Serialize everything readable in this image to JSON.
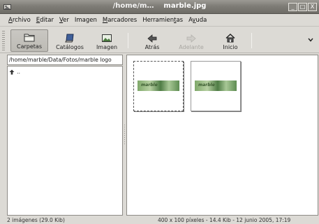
{
  "window": {
    "path": "/home/m…",
    "file": "marble.jpg",
    "controls": [
      "_",
      "□",
      "X"
    ]
  },
  "menubar": [
    {
      "pre": "",
      "u": "A",
      "post": "rchivo"
    },
    {
      "pre": "",
      "u": "E",
      "post": "ditar"
    },
    {
      "pre": "",
      "u": "V",
      "post": "er"
    },
    {
      "pre": "Imagen",
      "u": "",
      "post": ""
    },
    {
      "pre": "",
      "u": "M",
      "post": "arcadores"
    },
    {
      "pre": "Herramien",
      "u": "t",
      "post": "as"
    },
    {
      "pre": "A",
      "u": "y",
      "post": "uda"
    }
  ],
  "toolbar": {
    "carpetas": "Carpetas",
    "catalogos": "Catálogos",
    "imagen": "Imagen",
    "atras": "Atrás",
    "adelante": "Adelante",
    "inicio": "Inicio"
  },
  "path_field": "/home/marble/Data/Fotos/marble logo",
  "tree": {
    "parent_label": ".."
  },
  "thumbnails": [
    {
      "text": "marble",
      "selected": true
    },
    {
      "text": "marble",
      "selected": false
    }
  ],
  "status": {
    "left": "2 imágenes (29.0 Kib)",
    "right": "400 x 100 píxeles - 14.4 Kib - 12 junio 2005, 17:19"
  }
}
